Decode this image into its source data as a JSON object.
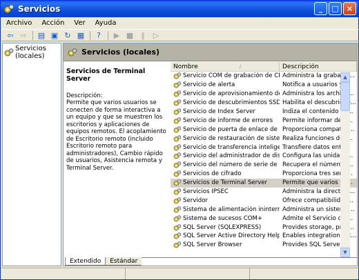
{
  "window": {
    "title": "Servicios"
  },
  "menu": [
    "Archivo",
    "Acción",
    "Ver",
    "Ayuda"
  ],
  "tree": {
    "root_label": "Servicios (locales)"
  },
  "panel": {
    "header_title": "Servicios (locales)",
    "selected_title": "Servicios de Terminal Server",
    "description_label": "Descripción:",
    "description_text": "Permite que varios usuarios se conecten de forma interactiva a un equipo y que se muestren los escritorios y aplicaciones de equipos remotos. El acoplamiento de Escritorio remoto (incluido Escritorio remoto para administradores), Cambio rápido de usuarios, Asistencia remota y Terminal Server."
  },
  "list": {
    "columns": {
      "name": "Nombre",
      "description": "Descripción"
    },
    "rows": [
      {
        "name": "Servicio COM de grabación de CD de ...",
        "description": "Administra la grabació..."
      },
      {
        "name": "Servicio de alerta",
        "description": "Notifica a usuarios y ..."
      },
      {
        "name": "Servicio de aprovisionamiento de red",
        "description": "Administra los archivo..."
      },
      {
        "name": "Servicio de descubrimientos SSDP",
        "description": "Habilita el descubrimie..."
      },
      {
        "name": "Servicio de Index Server",
        "description": "Indiza el contenido y l..."
      },
      {
        "name": "Servicio de informe de errores",
        "description": "Permite informar de e..."
      },
      {
        "name": "Servicio de puerta de enlace de cap...",
        "description": "Proporciona compatibi..."
      },
      {
        "name": "Servicio de restauración de sistema",
        "description": "Realiza funciones de r..."
      },
      {
        "name": "Servicio de transferencia inteligente ...",
        "description": "Transfiere datos entr..."
      },
      {
        "name": "Servicio del administrador de discos l...",
        "description": "Configura las unidade..."
      },
      {
        "name": "Servicio del número de serie de medi...",
        "description": "Recupera el número d..."
      },
      {
        "name": "Servicios de cifrado",
        "description": "Proporciona tres servi..."
      },
      {
        "name": "Servicios de Terminal Server",
        "description": "Permite que varios us...",
        "selected": true
      },
      {
        "name": "Servicios IPSEC",
        "description": "Administra la directiva..."
      },
      {
        "name": "Servidor",
        "description": "Ofrece compatibilidad..."
      },
      {
        "name": "Sistema de alimentación ininterrumpida",
        "description": "Administra un sistema..."
      },
      {
        "name": "Sistema de sucesos COM+",
        "description": "Admite el Servicio de ..."
      },
      {
        "name": "SQL Server (SQLEXPRESS)",
        "description": "Provides storage, proc..."
      },
      {
        "name": "SQL Server Active Directory Helper",
        "description": "Enables integration wit..."
      },
      {
        "name": "SQL Server Browser",
        "description": "Provides SQL Server ..."
      }
    ]
  },
  "tabs": [
    "Extendido",
    "Estándar"
  ]
}
